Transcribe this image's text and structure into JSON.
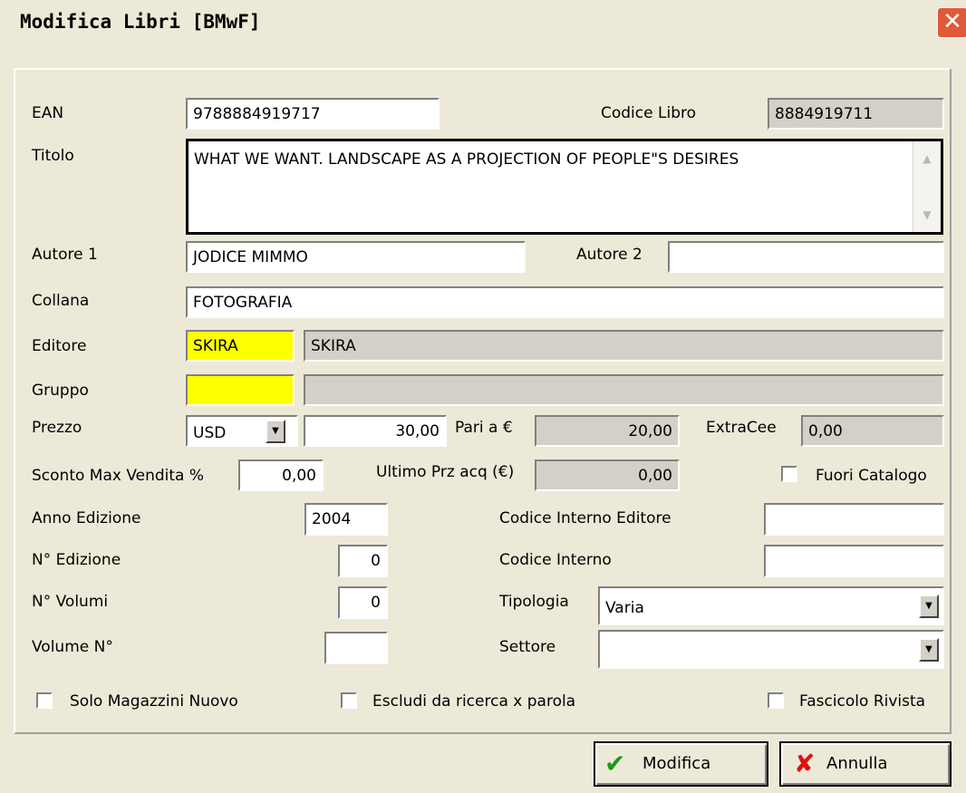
{
  "window": {
    "title": "Modifica Libri  [BMwF]",
    "close_icon": "close-icon"
  },
  "form": {
    "ean": {
      "label": "EAN",
      "value": "9788884919717"
    },
    "codice_libro": {
      "label": "Codice Libro",
      "value": "8884919711"
    },
    "titolo": {
      "label": "Titolo",
      "value": "WHAT WE WANT. LANDSCAPE AS A PROJECTION OF PEOPLE\"S DESIRES"
    },
    "autore1": {
      "label": "Autore 1",
      "value": "JODICE MIMMO"
    },
    "autore2": {
      "label": "Autore 2",
      "value": ""
    },
    "collana": {
      "label": "Collana",
      "value": "FOTOGRAFIA"
    },
    "editore": {
      "label": "Editore",
      "code": "SKIRA",
      "name": "SKIRA"
    },
    "gruppo": {
      "label": "Gruppo",
      "code": "",
      "name": ""
    },
    "prezzo": {
      "label": "Prezzo",
      "currency": "USD",
      "value": "30,00"
    },
    "pari_a": {
      "label": "Pari a €",
      "value": "20,00"
    },
    "extracee": {
      "label": "ExtraCee",
      "value": "0,00"
    },
    "sconto": {
      "label": "Sconto Max Vendita %",
      "value": "0,00"
    },
    "ultimo_prz": {
      "label": "Ultimo Prz acq (€)",
      "value": "0,00"
    },
    "fuori_catalogo": {
      "label": "Fuori Catalogo",
      "checked": false
    },
    "anno_edizione": {
      "label": "Anno Edizione",
      "value": "2004"
    },
    "codice_interno_editore": {
      "label": "Codice Interno Editore",
      "value": ""
    },
    "n_edizione": {
      "label": "N° Edizione",
      "value": "0"
    },
    "codice_interno": {
      "label": "Codice Interno",
      "value": ""
    },
    "n_volumi": {
      "label": "N° Volumi",
      "value": "0"
    },
    "tipologia": {
      "label": "Tipologia",
      "value": "Varia"
    },
    "volume_n": {
      "label": "Volume N°",
      "value": ""
    },
    "settore": {
      "label": "Settore",
      "value": ""
    },
    "solo_magazzini": {
      "label": "Solo Magazzini Nuovo",
      "checked": false
    },
    "escludi_ricerca": {
      "label": "Escludi da ricerca x parola",
      "checked": false
    },
    "fascicolo": {
      "label": "Fascicolo Rivista",
      "checked": false
    }
  },
  "buttons": {
    "modifica": {
      "label": "Modifica",
      "icon": "checkmark-icon",
      "icon_color": "#1a9a1a"
    },
    "annulla": {
      "label": "Annulla",
      "icon": "x-icon",
      "icon_color": "#e01010"
    }
  },
  "colors": {
    "window_bg": "#ece9d8",
    "highlight_field": "#ffff00",
    "readonly_field": "#d4d0c8"
  }
}
